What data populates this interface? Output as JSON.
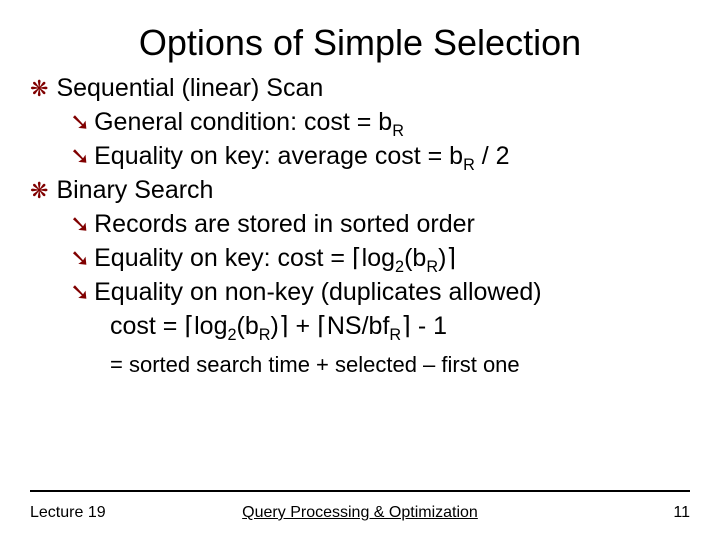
{
  "title": "Options of Simple Selection",
  "l1a": "Sequential (linear) Scan",
  "l2a": "General condition: cost = b",
  "l2a_sub": "R",
  "l2b": "Equality on key: average cost = b",
  "l2b_sub": "R",
  "l2b_tail": " / 2",
  "l1b": "Binary Search",
  "l2c": "Records are stored in sorted order",
  "l2d_pre": "Equality on key: cost = ",
  "l2d_ceil_l": "⌈",
  "l2d_log": "log",
  "l2d_logsub": "2",
  "l2d_arg": "(b",
  "l2d_argsub": "R",
  "l2d_argclose": ")",
  "l2d_ceil_r": "⌉",
  "l2e": "Equality on non-key (duplicates allowed)",
  "l3_pre": "cost = ",
  "l3_c1l": "⌈",
  "l3_log": "log",
  "l3_logsub": "2",
  "l3_arg": "(b",
  "l3_argsub": "R",
  "l3_argclose": ")",
  "l3_c1r": "⌉",
  "l3_plus": " + ",
  "l3_c2l": "⌈",
  "l3_ns": "NS/bf",
  "l3_nssub": "R",
  "l3_c2r": "⌉",
  "l3_tail": " - 1",
  "note": "= sorted search time + selected – first one",
  "footer": {
    "left": "Lecture 19",
    "center": "Query Processing & Optimization",
    "right": "11"
  }
}
